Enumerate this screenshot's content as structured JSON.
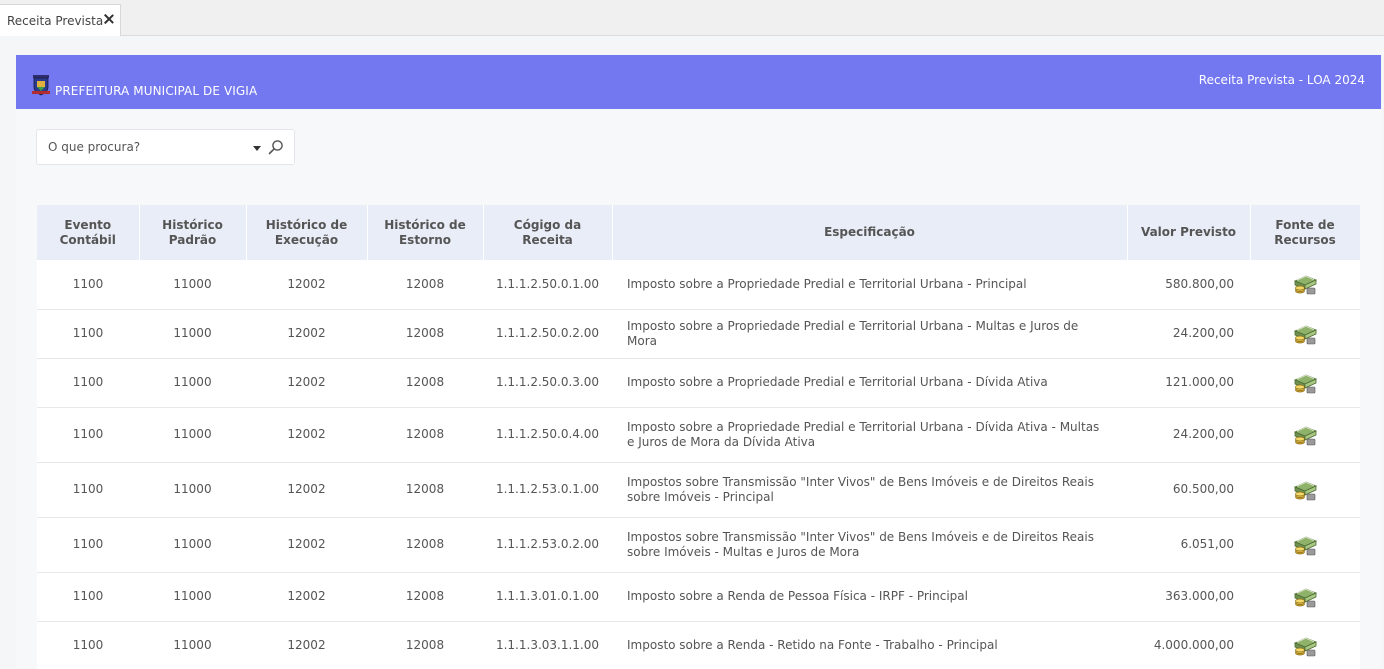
{
  "tab": {
    "label": "Receita Prevista"
  },
  "header": {
    "org_name": "PREFEITURA MUNICIPAL DE VIGIA",
    "page_title": "Receita Prevista - LOA 2024",
    "brand_color": "#7478f0"
  },
  "search": {
    "placeholder": "O que procura?",
    "value": ""
  },
  "icons": {
    "crest": "municipal-crest-icon",
    "caret": "caret-down-icon",
    "search": "search-icon",
    "close": "close-icon",
    "money": "money-stack-icon"
  },
  "table": {
    "columns": [
      "Evento Contábil",
      "Histórico Padrão",
      "Histórico de Execução",
      "Histórico de Estorno",
      "Cógigo da Receita",
      "Especificação",
      "Valor Previsto",
      "Fonte de Recursos"
    ],
    "rows": [
      [
        "1100",
        "11000",
        "12002",
        "12008",
        "1.1.1.2.50.0.1.00",
        "Imposto sobre a Propriedade Predial e Territorial Urbana - Principal",
        "580.800,00"
      ],
      [
        "1100",
        "11000",
        "12002",
        "12008",
        "1.1.1.2.50.0.2.00",
        "Imposto sobre a Propriedade Predial e Territorial Urbana - Multas e Juros de Mora",
        "24.200,00"
      ],
      [
        "1100",
        "11000",
        "12002",
        "12008",
        "1.1.1.2.50.0.3.00",
        "Imposto sobre a Propriedade Predial e Territorial Urbana - Dívida Ativa",
        "121.000,00"
      ],
      [
        "1100",
        "11000",
        "12002",
        "12008",
        "1.1.1.2.50.0.4.00",
        "Imposto sobre a Propriedade Predial e Territorial Urbana - Dívida Ativa - Multas e Juros de Mora da Dívida Ativa",
        "24.200,00"
      ],
      [
        "1100",
        "11000",
        "12002",
        "12008",
        "1.1.1.2.53.0.1.00",
        "Impostos sobre Transmissão \"Inter Vivos\" de Bens Imóveis e de Direitos Reais sobre Imóveis - Principal",
        "60.500,00"
      ],
      [
        "1100",
        "11000",
        "12002",
        "12008",
        "1.1.1.2.53.0.2.00",
        "Impostos sobre Transmissão \"Inter Vivos\" de Bens Imóveis e de Direitos Reais sobre Imóveis - Multas e Juros de Mora",
        "6.051,00"
      ],
      [
        "1100",
        "11000",
        "12002",
        "12008",
        "1.1.1.3.01.0.1.00",
        "Imposto sobre a Renda de Pessoa Física - IRPF - Principal",
        "363.000,00"
      ],
      [
        "1100",
        "11000",
        "12002",
        "12008",
        "1.1.1.3.03.1.1.00",
        "Imposto sobre a Renda - Retido na Fonte - Trabalho - Principal",
        "4.000.000,00"
      ]
    ]
  }
}
